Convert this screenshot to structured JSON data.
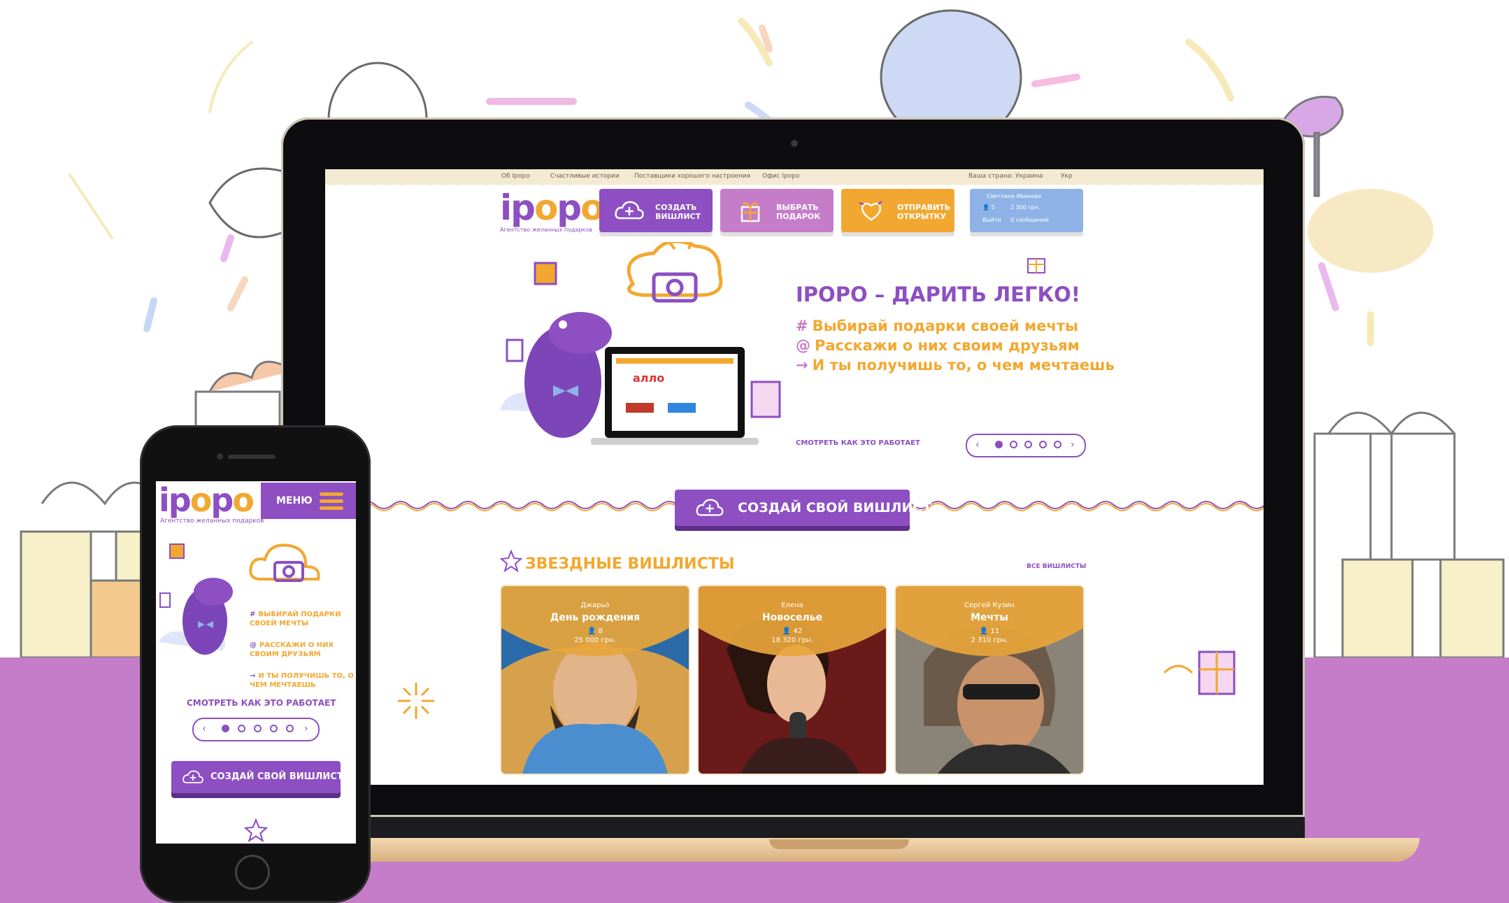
{
  "colors": {
    "brand_purple": "#8d4fc2",
    "accent_orange": "#f2a830",
    "floor_purple": "#c57dca",
    "nav_pink": "#c57dca",
    "nav_blue": "#8fb2e6"
  },
  "desktop": {
    "top_links": [
      "Об Ipopo",
      "Счастливые истории",
      "Поставщики хорошего настроения",
      "Офис Ipopo"
    ],
    "top_right": [
      "Ваша страна: Украина",
      "Укр"
    ],
    "logo": {
      "part1": "ip",
      "part2": "o",
      "part3": "p",
      "part4": "o"
    },
    "tagline": "Агентство желанных подарков",
    "nav": [
      {
        "label_line1": "СОЗДАТЬ",
        "label_line2": "ВИШЛИСТ",
        "color": "#8d4fc2",
        "icon": "cloud-plus-icon"
      },
      {
        "label_line1": "ВЫБРАТЬ",
        "label_line2": "ПОДАРОК",
        "color": "#c57dca",
        "icon": "gift-icon"
      },
      {
        "label_line1": "ОТПРАВИТЬ",
        "label_line2": "ОТКРЫТКУ",
        "color": "#f2a830",
        "icon": "heart-card-icon"
      }
    ],
    "account": {
      "greeting": "Светлана Иванова",
      "stat_1": "5",
      "stat_2": "2 300 грн.",
      "logout": "Выйти",
      "messages": "0 сообщений"
    },
    "hero": {
      "title": "IPOPO – ДАРИТЬ ЛЕГКО!",
      "lines": [
        {
          "marker": "#",
          "text": "Выбирай подарки своей мечты"
        },
        {
          "marker": "@",
          "text": "Расскажи о них своим друзьям"
        },
        {
          "marker": "→",
          "text": "И ты получишь то, о чем мечтаешь"
        }
      ],
      "how_link": "СМОТРЕТЬ КАК ЭТО РАБОТАЕТ",
      "pager": {
        "prev": "‹",
        "next": "›",
        "total": 5,
        "active": 1
      }
    },
    "cta": "СОЗДАЙ СВОЙ ВИШЛИСТ",
    "section": {
      "title": "ЗВЕЗДНЫЕ ВИШЛИСТЫ",
      "all": "ВСЕ ВИШЛИСТЫ",
      "cards": [
        {
          "who": "Джарьо",
          "event": "День рождения",
          "count": "8",
          "sum": "25 000 грн."
        },
        {
          "who": "Елена",
          "event": "Новоселье",
          "count": "42",
          "sum": "18 320 грн."
        },
        {
          "who": "Сергей Кузин",
          "event": "Мечты",
          "count": "11",
          "sum": "2 310 грн."
        }
      ]
    }
  },
  "mobile": {
    "logo": {
      "part1": "ip",
      "part2": "o",
      "part3": "p",
      "part4": "o"
    },
    "tagline": "Агентство желанных подарков",
    "menu": "МЕНЮ",
    "lines": [
      {
        "marker": "#",
        "text": "ВЫБИРАЙ ПОДАРКИ СВОЕЙ МЕЧТЫ"
      },
      {
        "marker": "@",
        "text": "РАССКАЖИ О НИХ СВОИМ ДРУЗЬЯМ"
      },
      {
        "marker": "→",
        "text": "И ТЫ ПОЛУЧИШЬ ТО, О ЧЕМ МЕЧТАЕШЬ"
      }
    ],
    "how_link": "СМОТРЕТЬ КАК ЭТО РАБОТАЕТ",
    "pager": {
      "prev": "‹",
      "next": "›",
      "total": 5,
      "active": 1
    },
    "cta": "СОЗДАЙ СВОЙ ВИШЛИСТ"
  }
}
